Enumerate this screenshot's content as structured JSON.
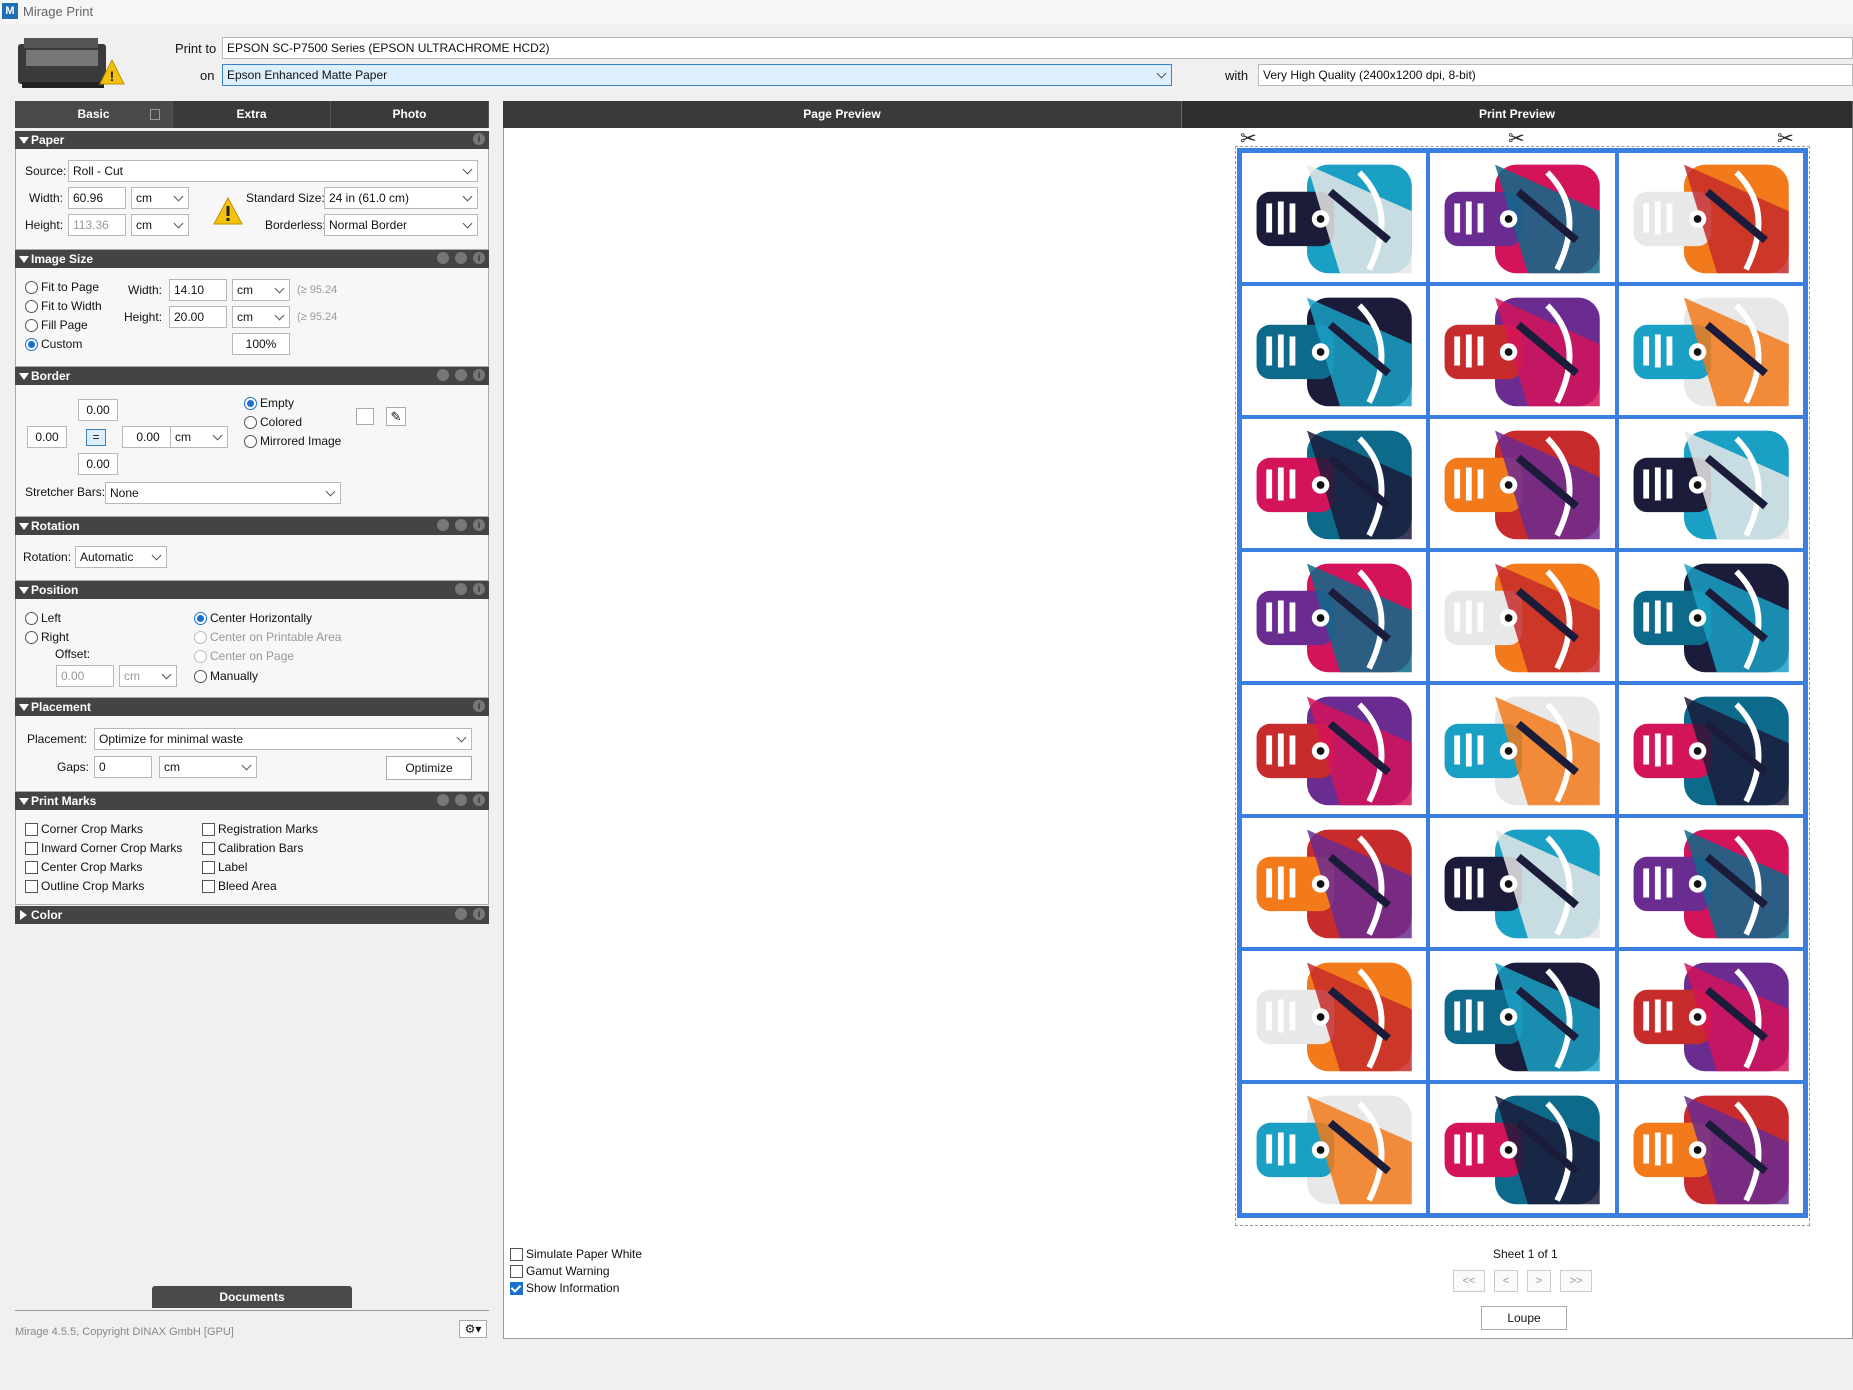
{
  "window": {
    "title": "Mirage Print",
    "logo": "M"
  },
  "header": {
    "print_to_label": "Print to",
    "printer": "EPSON SC-P7500 Series (EPSON ULTRACHROME HCD2)",
    "on_label": "on",
    "media": "Epson Enhanced Matte Paper",
    "with_label": "with",
    "quality": "Very High Quality (2400x1200 dpi, 8-bit)"
  },
  "left_tabs": [
    "Basic",
    "Extra",
    "Photo"
  ],
  "paper": {
    "title": "Paper",
    "source_label": "Source:",
    "source": "Roll - Cut",
    "width_label": "Width:",
    "width": "60.96",
    "width_unit": "cm",
    "height_label": "Height:",
    "height": "113.36",
    "height_unit": "cm",
    "standard_size_label": "Standard Size:",
    "standard_size": "24 in (61.0 cm)",
    "borderless_label": "Borderless:",
    "borderless": "Normal Border"
  },
  "image_size": {
    "title": "Image Size",
    "options": [
      "Fit to Page",
      "Fit to Width",
      "Fill Page",
      "Custom"
    ],
    "selected": "Custom",
    "width_label": "Width:",
    "width": "14.10",
    "width_unit": "cm",
    "width_hint": "(≥ 95.24",
    "height_label": "Height:",
    "height": "20.00",
    "height_unit": "cm",
    "height_hint": "(≥ 95.24",
    "scale": "100%"
  },
  "border": {
    "title": "Border",
    "top": "0.00",
    "left": "0.00",
    "right": "0.00",
    "bottom": "0.00",
    "unit": "cm",
    "link": "=",
    "options": [
      "Empty",
      "Colored",
      "Mirrored Image"
    ],
    "selected": "Empty",
    "stretcher_label": "Stretcher Bars:",
    "stretcher": "None"
  },
  "rotation": {
    "title": "Rotation",
    "label": "Rotation:",
    "value": "Automatic"
  },
  "position": {
    "title": "Position",
    "left": "Left",
    "right": "Right",
    "offset_label": "Offset:",
    "offset": "0.00",
    "offset_unit": "cm",
    "center_h": "Center Horizontally",
    "center_printable": "Center on Printable Area",
    "center_page": "Center on Page",
    "manually": "Manually"
  },
  "placement": {
    "title": "Placement",
    "label": "Placement:",
    "value": "Optimize for minimal waste",
    "gaps_label": "Gaps:",
    "gaps": "0",
    "gaps_unit": "cm",
    "optimize": "Optimize"
  },
  "print_marks": {
    "title": "Print Marks",
    "col1": [
      "Corner Crop Marks",
      "Inward Corner Crop Marks",
      "Center Crop Marks",
      "Outline Crop Marks"
    ],
    "col2": [
      "Registration Marks",
      "Calibration Bars",
      "Label",
      "Bleed Area"
    ]
  },
  "color": {
    "title": "Color"
  },
  "documents_tab": "Documents",
  "copyright": "Mirage 4.5.5, Copyright DINAX GmbH [GPU]",
  "preview_tabs": {
    "page": "Page Preview",
    "print": "Print Preview"
  },
  "preview_options": {
    "simulate": "Simulate Paper White",
    "gamut": "Gamut Warning",
    "info": "Show Information"
  },
  "sheet_label": "Sheet 1 of 1",
  "nav": [
    "<<",
    "<",
    ">",
    ">>"
  ],
  "loupe": "Loupe",
  "layout": {
    "columns": 3,
    "rows": 8
  },
  "colors": {
    "accent": "#3a7fe0",
    "header": "#444444",
    "selected_field": "#ddeefc"
  }
}
